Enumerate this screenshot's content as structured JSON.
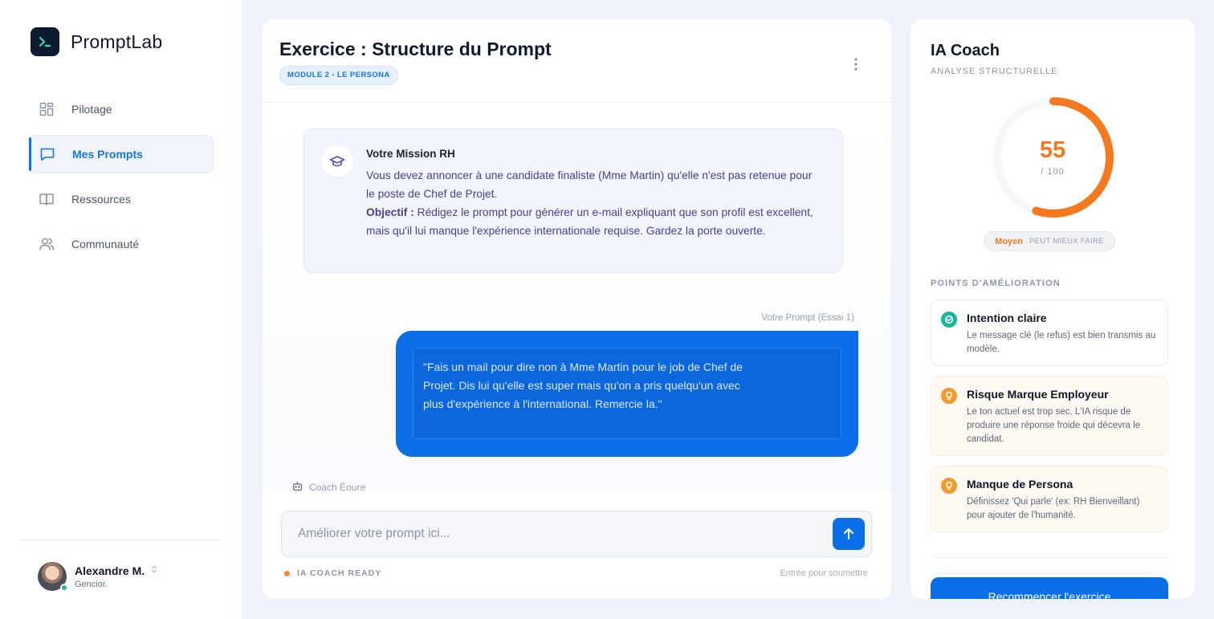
{
  "app": {
    "name": "PromptLab"
  },
  "sidebar": {
    "items": [
      {
        "label": "Pilotage",
        "icon": "grid-icon"
      },
      {
        "label": "Mes Prompts",
        "icon": "chat-icon",
        "active": true
      },
      {
        "label": "Ressources",
        "icon": "book-icon"
      },
      {
        "label": "Communauté",
        "icon": "users-icon"
      }
    ],
    "user": {
      "name": "Alexandre M.",
      "org": "Gencior."
    }
  },
  "main": {
    "title": "Exercice : Structure du Prompt",
    "module_badge": "MODULE 2 - LE PERSONA",
    "mission": {
      "title": "Votre Mission RH",
      "text": "Vous devez annoncer à une candidate finaliste (Mme Martin) qu'elle n'est pas retenue pour le poste de Chef de Projet.",
      "objective_label": "Objectif :",
      "objective_text": " Rédigez le prompt pour générer un e-mail expliquant que son profil est excellent, mais qu'il lui manque l'expérience internationale requise. Gardez la porte ouverte."
    },
    "prompt_meta": "Votre Prompt (Essai 1)",
    "prompt_text": "\"Fais un mail pour dire non à Mme Martin pour le job de Chef de Projet. Dis lui qu'elle est super mais qu'on a pris quelqu'un avec plus d'expérience à l'international. Remercie la.\"",
    "coach_tag": "Coach Éoure",
    "composer_placeholder": "Améliorer votre prompt ici...",
    "status": "IA COACH READY",
    "hint": "Entrée pour soumettre"
  },
  "coach": {
    "title": "IA Coach",
    "subtitle": "ANALYSE STRUCTURELLE",
    "score": 55,
    "score_max": "/ 100",
    "level": "Moyen",
    "level_desc": "PEUT MIEUX FAIRE",
    "section_title": "POINTS D'AMÉLIORATION",
    "tips": [
      {
        "title": "Intention claire",
        "body": "Le message clé (le refus) est bien transmis au modèle.",
        "kind": "ok"
      },
      {
        "title": "Risque Marque Employeur",
        "body": "Le ton actuel est trop sec. L'IA risque de produire une réponse froide qui décevra le candidat.",
        "kind": "warn"
      },
      {
        "title": "Manque de Persona",
        "body": "Définissez 'Qui parle' (ex: RH Bienveillant) pour ajouter de l'humanité.",
        "kind": "warn"
      }
    ],
    "restart_label": "Recommencer l'exercice"
  },
  "colors": {
    "accent": "#0a6fe8",
    "score": "#f07a24",
    "ok": "#15b99a",
    "warn": "#f29a2e"
  }
}
